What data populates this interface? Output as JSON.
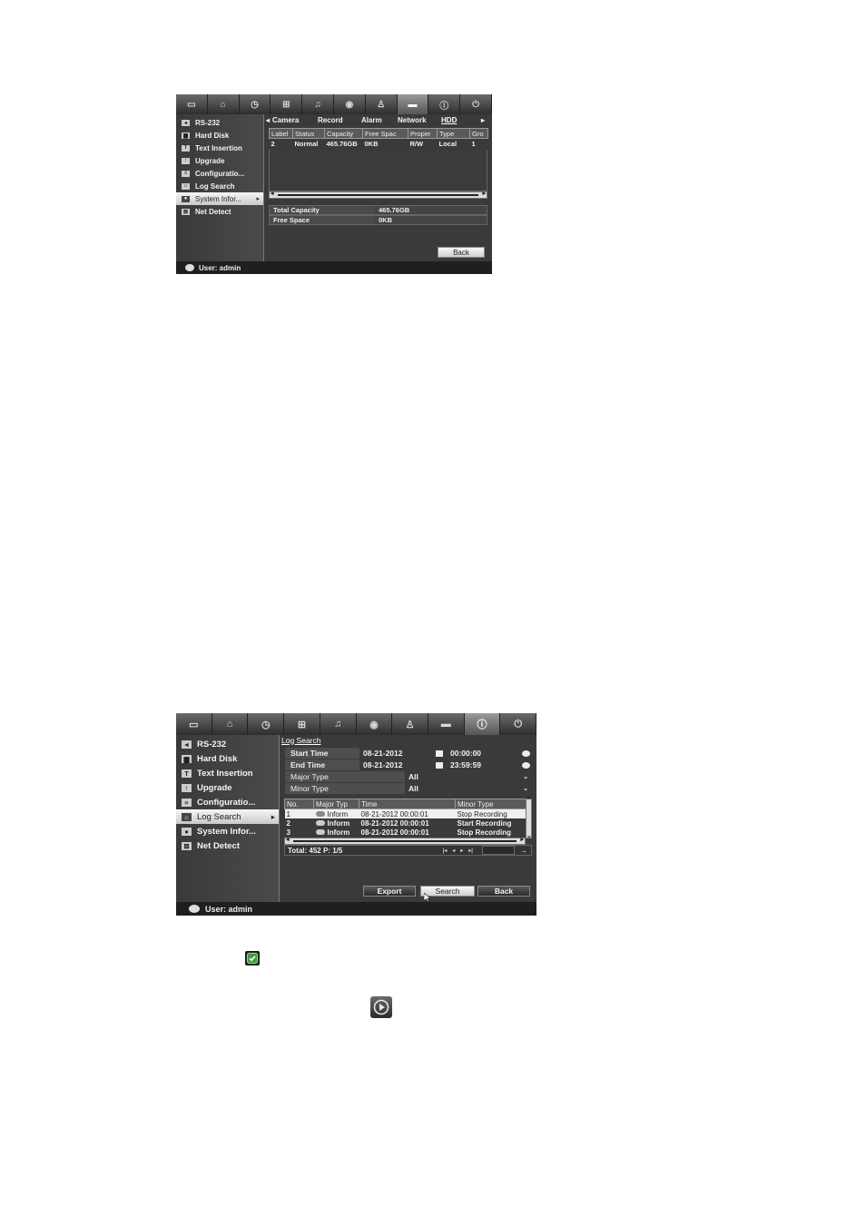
{
  "screen1": {
    "toolbar_icons": [
      "monitor-icon",
      "camera-icon",
      "record-icon",
      "network-icon",
      "alarm-icon",
      "disk-icon",
      "user-icon",
      "device-icon",
      "info-icon",
      "power-icon"
    ],
    "sidebar": [
      {
        "label": "RS-232",
        "icon": "serial-icon"
      },
      {
        "label": "Hard Disk",
        "icon": "harddisk-icon"
      },
      {
        "label": "Text Insertion",
        "icon": "text-icon"
      },
      {
        "label": "Upgrade",
        "icon": "upgrade-icon"
      },
      {
        "label": "Configuratio...",
        "icon": "config-icon"
      },
      {
        "label": "Log Search",
        "icon": "log-icon"
      },
      {
        "label": "System Infor...",
        "icon": "sysinfo-icon",
        "arrow": "▸"
      },
      {
        "label": "Net Detect",
        "icon": "netdetect-icon"
      }
    ],
    "tabs": {
      "left_arrow": "◂",
      "items": [
        "Camera",
        "Record",
        "Alarm",
        "Network",
        "HDD"
      ],
      "right_arrow": "▸"
    },
    "columns": [
      "Label",
      "Status",
      "Capacity",
      "Free Spac",
      "Proper",
      "Type",
      "Gro"
    ],
    "rows": [
      [
        "2",
        "Normal",
        "465.76GB",
        "0KB",
        "R/W",
        "Local",
        "1"
      ]
    ],
    "total_capacity_label": "Total Capacity",
    "total_capacity_value": "465.76GB",
    "free_space_label": "Free Space",
    "free_space_value": "0KB",
    "back_label": "Back",
    "user_label": "User: admin"
  },
  "screen2": {
    "toolbar_icons": [
      "monitor-icon",
      "camera-icon",
      "record-icon",
      "network-icon",
      "alarm-icon",
      "disk-icon",
      "user-icon",
      "device-icon",
      "info-icon",
      "power-icon"
    ],
    "sidebar": [
      {
        "label": "RS-232",
        "icon": "serial-icon"
      },
      {
        "label": "Hard Disk",
        "icon": "harddisk-icon"
      },
      {
        "label": "Text Insertion",
        "icon": "text-icon"
      },
      {
        "label": "Upgrade",
        "icon": "upgrade-icon"
      },
      {
        "label": "Configuratio...",
        "icon": "config-icon"
      },
      {
        "label": "Log Search",
        "icon": "log-icon",
        "arrow": "▸"
      },
      {
        "label": "System Infor...",
        "icon": "sysinfo-icon"
      },
      {
        "label": "Net Detect",
        "icon": "netdetect-icon"
      }
    ],
    "tab": "Log Search",
    "start_time_label": "Start Time",
    "start_date": "08-21-2012",
    "start_time": "00:00:00",
    "end_time_label": "End Time",
    "end_date": "08-21-2012",
    "end_time": "23:59:59",
    "major_type_label": "Major Type",
    "major_type_value": "All",
    "minor_type_label": "Minor Type",
    "minor_type_value": "All",
    "columns": [
      "No.",
      "Major Typ",
      "Time",
      "Minor Type"
    ],
    "rows": [
      [
        "1",
        "Inform",
        "08-21-2012 00:00:01",
        "Stop Recording"
      ],
      [
        "2",
        "Inform",
        "08-21-2012 00:00:01",
        "Start Recording"
      ],
      [
        "3",
        "Inform",
        "08-21-2012 00:00:01",
        "Stop Recording"
      ]
    ],
    "total": "Total: 452  P: 1/5",
    "pager": [
      "|◂",
      "◂",
      "▸",
      "▸|"
    ],
    "go": "→",
    "export_label": "Export",
    "search_label": "Search",
    "back_label": "Back",
    "user_label": "User: admin"
  },
  "doc_icons": {
    "check": "check-icon",
    "play": "play-icon"
  }
}
